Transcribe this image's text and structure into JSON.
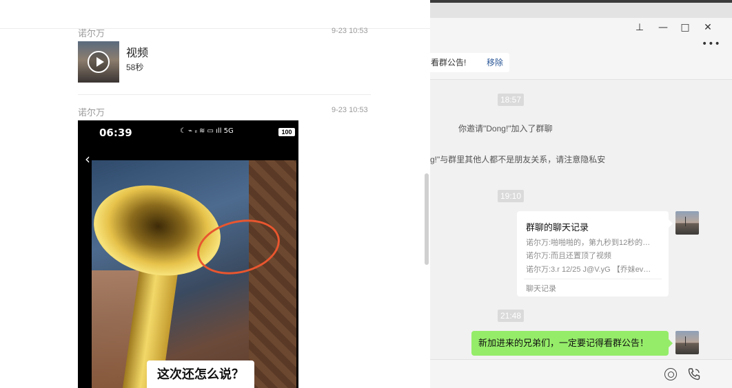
{
  "favorites_panel": {
    "item1": {
      "sender": "诺尔万",
      "time": "9-23 10:53",
      "type_label": "视频",
      "duration": "58秒",
      "thumb_icon": "play-icon"
    },
    "item2": {
      "sender": "诺尔万",
      "time": "9-23 10:53",
      "phone_screenshot": {
        "clock": "06:39",
        "status_icons": "☾ ⌁ ᵢₗ ≋ ▭ ıll 5G",
        "battery": "100",
        "back_icon": "back-chevron-icon",
        "caption": "这次还怎么说？"
      }
    }
  },
  "chat_window": {
    "window_controls": {
      "pin": "⊥",
      "minimize": "—",
      "maximize": "□",
      "close": "✕"
    },
    "more_label": "•••",
    "notice_bar": {
      "text": "看群公告!",
      "remove_label": "移除"
    },
    "messages": {
      "time1": "18:57",
      "sys1": "你邀请\"Dong!\"加入了群聊",
      "sys2": "g!\"与群里其他人都不是朋友关系，请注意隐私安",
      "time2": "19:10",
      "merged": {
        "title": "群聊的聊天记录",
        "lines": [
          "诺尔万:啪啪啪的，第九秒到12秒的…",
          "诺尔万:而且还置顶了视频",
          "诺尔万:3.r 12/25 J@V.yG 【乔妹ev…"
        ],
        "footer": "聊天记录"
      },
      "time3": "21:48",
      "outgoing": "新加进来的兄弟们，一定要记得看群公告！"
    },
    "input_icons": [
      "voice-chat-icon",
      "phone-call-icon"
    ]
  },
  "colors": {
    "bubble_green": "#95ec69",
    "chat_bg": "#f1f1f1",
    "link_blue": "#2b5797",
    "annotation_red": "#e8562f"
  }
}
